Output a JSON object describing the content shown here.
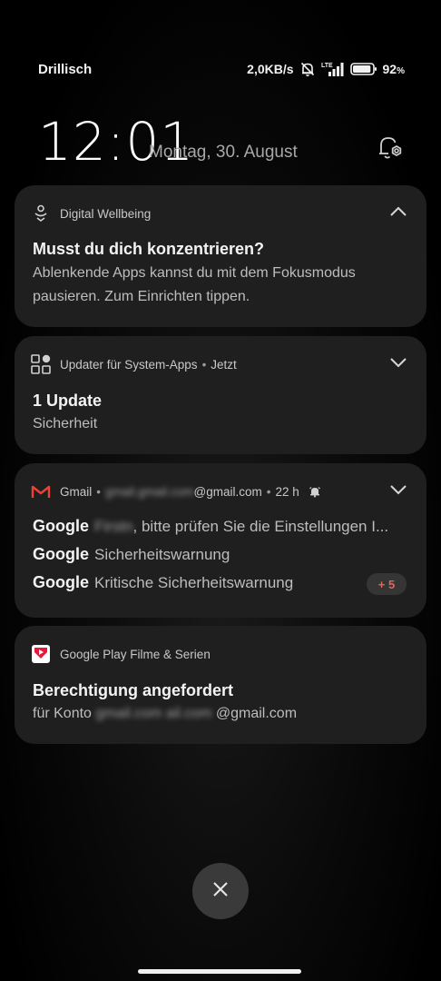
{
  "status_bar": {
    "carrier": "Drillisch",
    "net_speed": "2,0KB/s",
    "network": "LTE",
    "battery": "92",
    "battery_pct_sign": "%",
    "battery_level": 0.92
  },
  "header": {
    "time": "12:01",
    "date": "Montag, 30. August"
  },
  "notifications": [
    {
      "app": "Digital Wellbeing",
      "title": "Musst du dich konzentrieren?",
      "body": "Ablenkende Apps kannst du mit dem Fokusmodus pausieren. Zum Einrichten tippen.",
      "expanded": true
    },
    {
      "app": "Updater für System-Apps",
      "time": "Jetzt",
      "title": "1 Update",
      "body": "Sicherheit"
    },
    {
      "app": "Gmail",
      "account_blurred": "gmail.gmail.com",
      "account_domain": "@gmail.com",
      "time": "22 h",
      "rows": [
        {
          "sender": "Google",
          "blurred": "Firstn",
          "text": "bitte prüfen Sie die Einstellungen I..."
        },
        {
          "sender": "Google",
          "text": "Sicherheitswarnung"
        },
        {
          "sender": "Google",
          "text": "Kritische Sicherheitswarnung"
        }
      ],
      "more_count": "+ 5"
    },
    {
      "app": "Google Play Filme & Serien",
      "title": "Berechtigung angefordert",
      "body_prefix": "für Konto",
      "body_blurred": "gmail.com ail.com",
      "body_suffix": "@gmail.com"
    }
  ],
  "colors": {
    "card_bg": "#1f1f1f",
    "badge_text": "#e0675a",
    "gmail_red": "#ea4335",
    "play_movies_red": "#e6193c"
  },
  "icons": {
    "mute": "bell-off-icon",
    "signal": "signal-icon",
    "battery": "battery-icon",
    "settings": "notification-settings-icon",
    "dismiss": "close-icon"
  }
}
